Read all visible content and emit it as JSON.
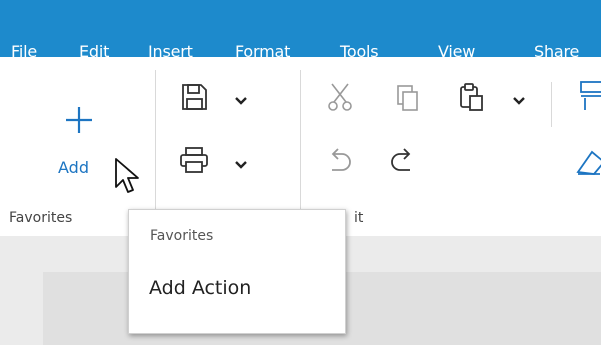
{
  "menu": {
    "items": [
      "File",
      "Edit",
      "Insert",
      "Format",
      "Tools",
      "View",
      "Share"
    ]
  },
  "ribbon": {
    "add_label": "Add",
    "groups": {
      "favorites": "Favorites",
      "edit_partial": "it"
    }
  },
  "popup": {
    "title": "Favorites",
    "item": "Add Action"
  },
  "colors": {
    "accent": "#1d8acc",
    "add_blue": "#1d75c2"
  },
  "icons": {
    "plus": "plus-icon",
    "save": "save-icon",
    "print": "print-icon",
    "cut": "cut-icon",
    "copy": "copy-icon",
    "paste": "paste-icon",
    "undo": "undo-icon",
    "redo": "redo-icon",
    "format_painter": "format-painter-icon",
    "eraser": "eraser-icon",
    "cursor": "mouse-pointer-icon"
  }
}
